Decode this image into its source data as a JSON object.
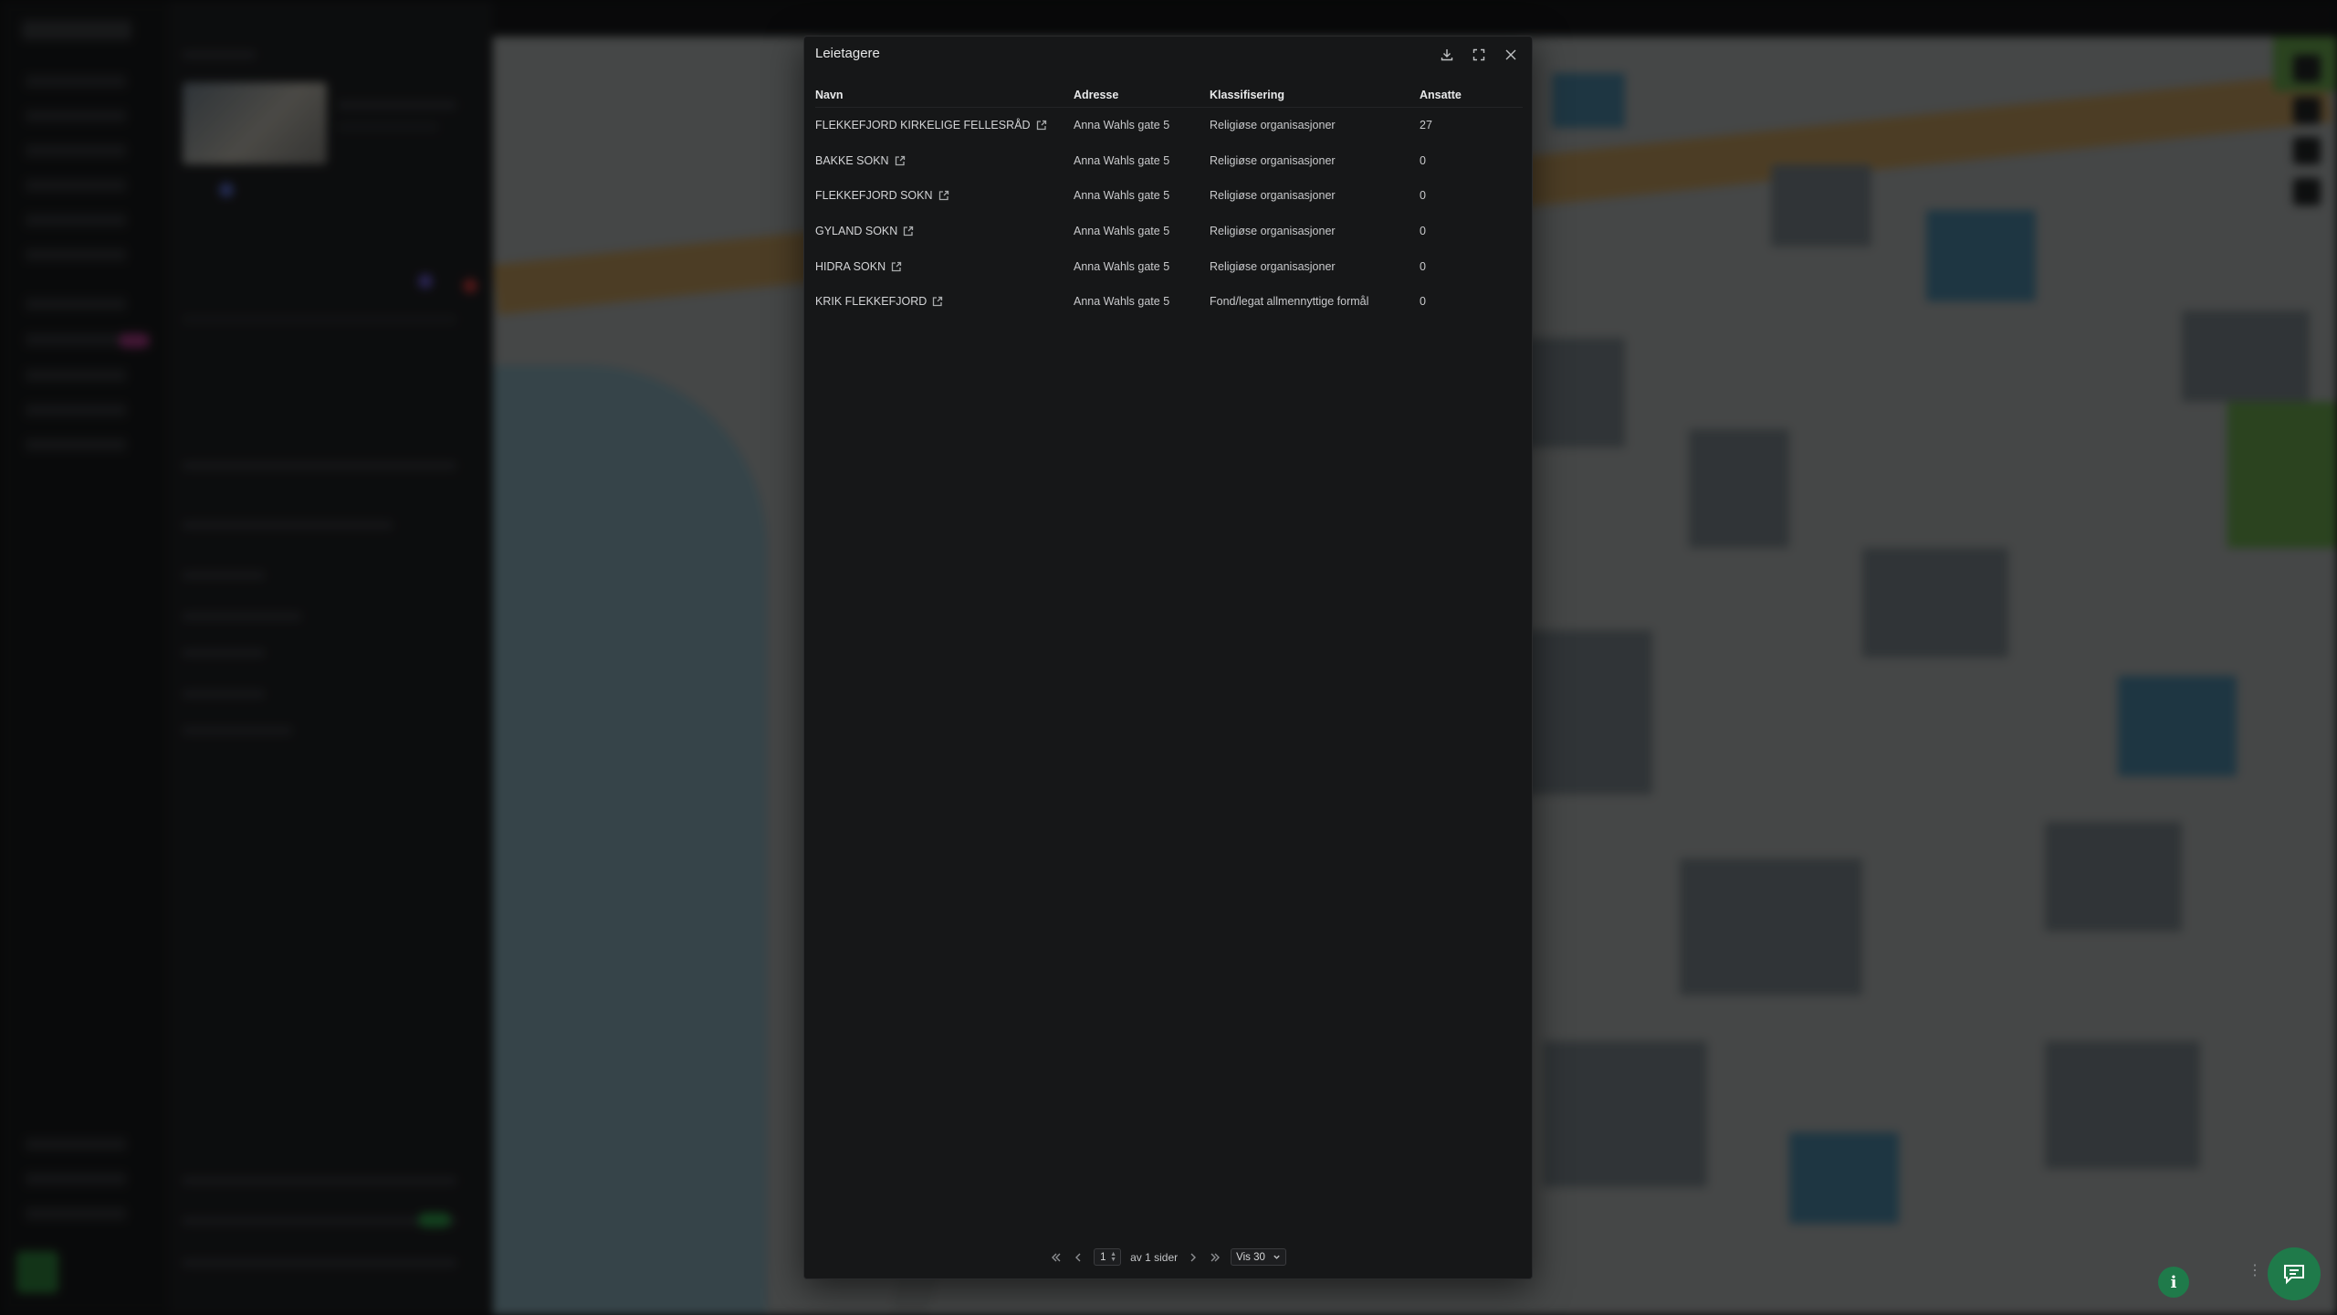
{
  "modal": {
    "title": "Leietagere",
    "download_icon": "download-icon",
    "fullscreen_icon": "expand-icon",
    "close_icon": "close-icon"
  },
  "table": {
    "columns": [
      "Navn",
      "Adresse",
      "Klassifisering",
      "Ansatte"
    ],
    "rows": [
      {
        "name": "FLEKKEFJORD KIRKELIGE FELLESRÅD",
        "address": "Anna Wahls gate 5",
        "classification": "Religiøse organisasjoner",
        "employees": "27"
      },
      {
        "name": "BAKKE SOKN",
        "address": "Anna Wahls gate 5",
        "classification": "Religiøse organisasjoner",
        "employees": "0"
      },
      {
        "name": "FLEKKEFJORD SOKN",
        "address": "Anna Wahls gate 5",
        "classification": "Religiøse organisasjoner",
        "employees": "0"
      },
      {
        "name": "GYLAND SOKN",
        "address": "Anna Wahls gate 5",
        "classification": "Religiøse organisasjoner",
        "employees": "0"
      },
      {
        "name": "HIDRA SOKN",
        "address": "Anna Wahls gate 5",
        "classification": "Religiøse organisasjoner",
        "employees": "0"
      },
      {
        "name": "KRIK FLEKKEFJORD",
        "address": "Anna Wahls gate 5",
        "classification": "Fond/legat allmennyttige formål",
        "employees": "0"
      }
    ]
  },
  "pagination": {
    "page": "1",
    "of_label": "av 1 sider",
    "page_size": "Vis 30"
  },
  "colors": {
    "accent_green": "#1f7a4a",
    "modal_bg": "#161718"
  }
}
